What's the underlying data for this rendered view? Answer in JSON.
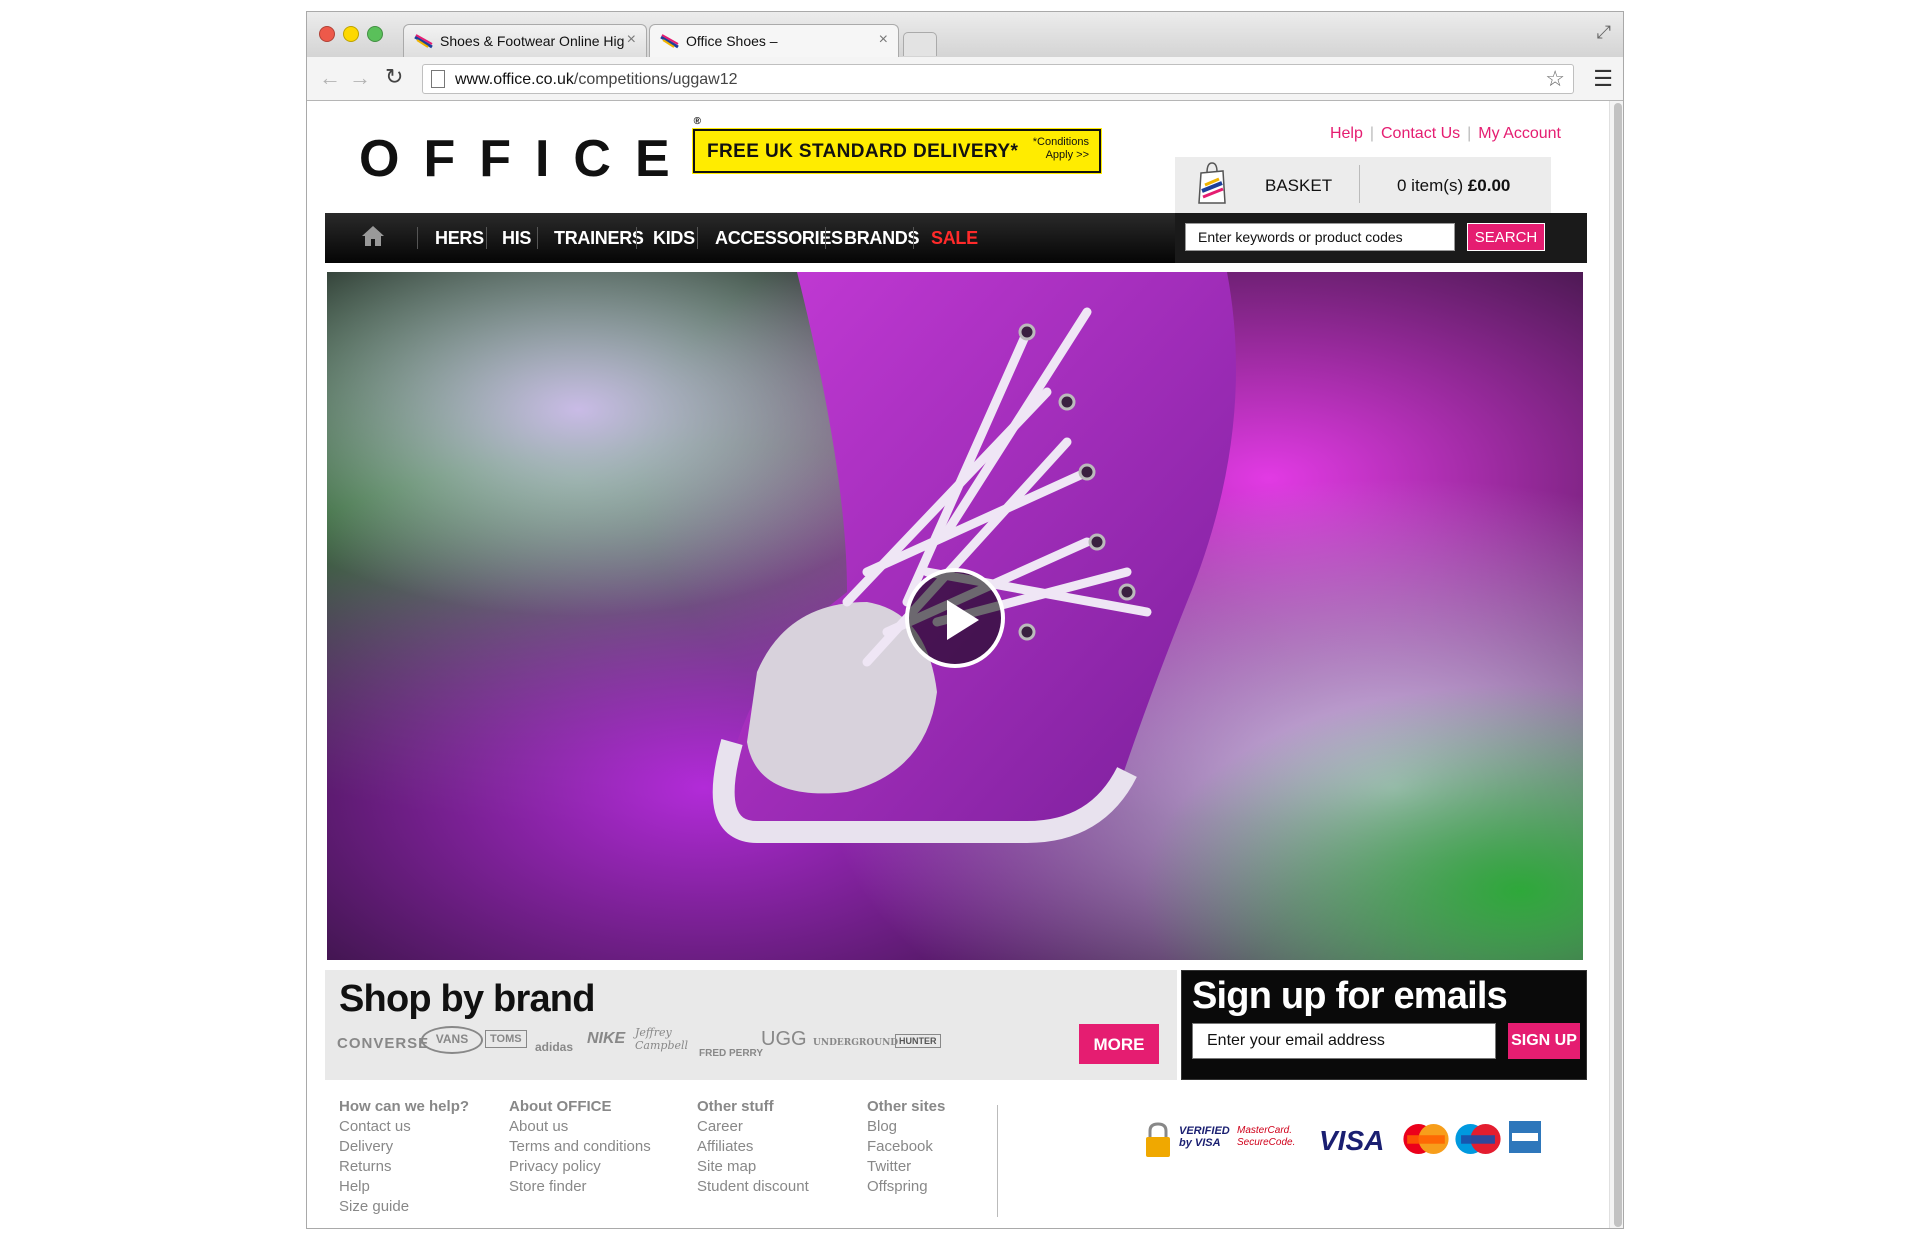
{
  "browser": {
    "tabs": [
      {
        "title": "Shoes & Footwear Online Hig",
        "active": false
      },
      {
        "title": "Office Shoes –",
        "active": true
      }
    ],
    "url_domain": "www.office.co.uk",
    "url_path": "/competitions/uggaw12"
  },
  "header": {
    "links": [
      "Help",
      "Contact Us",
      "My Account"
    ],
    "logo": "OFFICE",
    "delivery_banner": {
      "text": "FREE UK STANDARD DELIVERY*",
      "conditions": "*Conditions Apply >>"
    },
    "basket": {
      "label": "BASKET",
      "items_text": "0 item(s) ",
      "total": "£0.00"
    }
  },
  "nav": {
    "items": [
      "HERS",
      "HIS",
      "TRAINERS",
      "KIDS",
      "ACCESSORIES",
      "BRANDS",
      "SALE"
    ],
    "search_placeholder": "Enter keywords or product codes",
    "search_button": "SEARCH"
  },
  "shop_by_brand": {
    "title": "Shop by brand",
    "brands": [
      "CONVERSE",
      "VANS",
      "TOMS",
      "adidas",
      "NIKE",
      "Jeffrey Campbell",
      "FRED PERRY",
      "UGG",
      "UNDERGROUND",
      "HUNTER"
    ],
    "more_button": "MORE"
  },
  "signup": {
    "title": "Sign up for emails",
    "placeholder": "Enter your email address",
    "button": "SIGN UP"
  },
  "footer": {
    "columns": [
      {
        "heading": "How can we help?",
        "links": [
          "Contact us",
          "Delivery",
          "Returns",
          "Help",
          "Size guide"
        ]
      },
      {
        "heading": "About OFFICE",
        "links": [
          "About us",
          "Terms and conditions",
          "Privacy policy",
          "Store finder"
        ]
      },
      {
        "heading": "Other stuff",
        "links": [
          "Career",
          "Affiliates",
          "Site map",
          "Student discount"
        ]
      },
      {
        "heading": "Other sites",
        "links": [
          "Blog",
          "Facebook",
          "Twitter",
          "Offspring"
        ]
      }
    ],
    "security": [
      "VERIFIED by VISA",
      "MasterCard. SecureCode."
    ],
    "payments": [
      "VISA",
      "MasterCard",
      "Maestro",
      "American Express"
    ]
  },
  "colors": {
    "accent": "#e51d71",
    "delivery_yellow": "#ffec00",
    "sale_red": "#ff2a2a",
    "nav_bg": "#111111"
  }
}
